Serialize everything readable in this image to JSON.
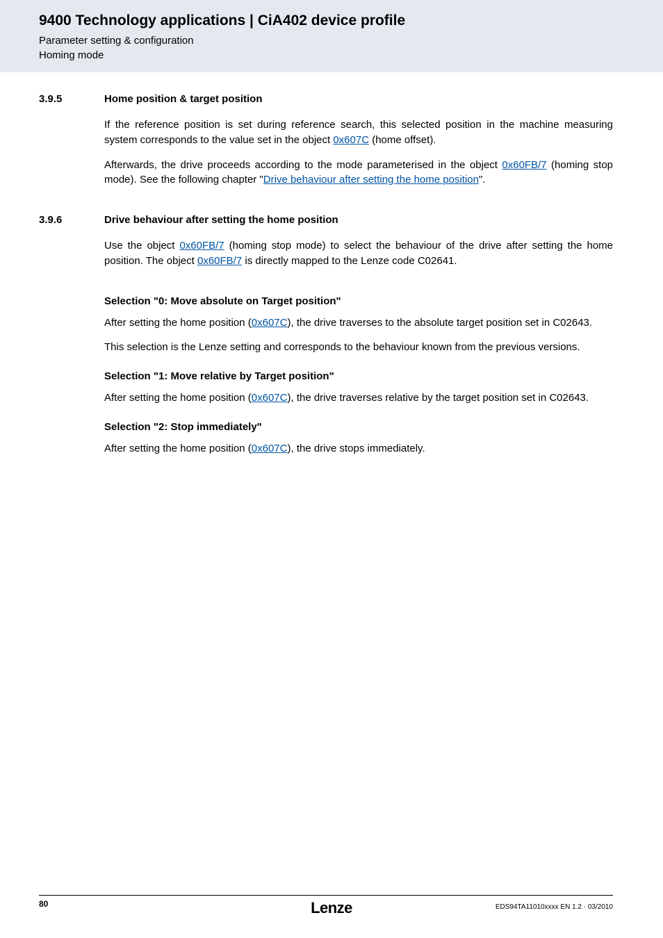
{
  "header": {
    "title": "9400 Technology applications | CiA402 device profile",
    "sub1": "Parameter setting & configuration",
    "sub2": "Homing mode"
  },
  "sections": [
    {
      "num": "3.9.5",
      "heading": "Home position & target position",
      "paras": [
        {
          "parts": [
            {
              "t": "If the reference position is set during reference search, this selected position in the machine measuring system corresponds to the value set in the object "
            },
            {
              "t": "0x607C",
              "link": true
            },
            {
              "t": " (home offset)."
            }
          ]
        },
        {
          "parts": [
            {
              "t": "Afterwards, the drive proceeds according to the mode parameterised in the object "
            },
            {
              "t": "0x60FB/7",
              "link": true
            },
            {
              "t": " (homing stop mode). See the following chapter \""
            },
            {
              "t": "Drive behaviour after setting the home position",
              "link": true
            },
            {
              "t": "\"."
            }
          ]
        }
      ]
    },
    {
      "num": "3.9.6",
      "heading": "Drive behaviour after setting the home position",
      "paras": [
        {
          "parts": [
            {
              "t": "Use the object "
            },
            {
              "t": "0x60FB/7",
              "link": true
            },
            {
              "t": " (homing stop mode) to select the behaviour of the drive after setting the home position. The object "
            },
            {
              "t": "0x60FB/7",
              "link": true
            },
            {
              "t": " is directly mapped to the Lenze code C02641."
            }
          ]
        }
      ],
      "subs": [
        {
          "title": "Selection \"0: Move absolute on Target position\"",
          "paras": [
            {
              "parts": [
                {
                  "t": "After setting the home position ("
                },
                {
                  "t": "0x607C",
                  "link": true
                },
                {
                  "t": "), the drive traverses to the absolute target position set in  C02643."
                }
              ]
            },
            {
              "parts": [
                {
                  "t": "This selection is the Lenze setting and corresponds to the behaviour known from the previous versions."
                }
              ]
            }
          ]
        },
        {
          "title": "Selection \"1: Move relative by Target position\"",
          "paras": [
            {
              "parts": [
                {
                  "t": "After setting the home position ("
                },
                {
                  "t": "0x607C",
                  "link": true
                },
                {
                  "t": "), the drive traverses relative by the target position set in C02643."
                }
              ]
            }
          ]
        },
        {
          "title": "Selection \"2: Stop immediately\"",
          "paras": [
            {
              "parts": [
                {
                  "t": "After setting the home position ("
                },
                {
                  "t": "0x607C",
                  "link": true
                },
                {
                  "t": "), the drive stops immediately."
                }
              ]
            }
          ]
        }
      ]
    }
  ],
  "footer": {
    "page": "80",
    "logo": "Lenze",
    "docid": "EDS94TA11010xxxx EN 1.2 · 03/2010"
  }
}
